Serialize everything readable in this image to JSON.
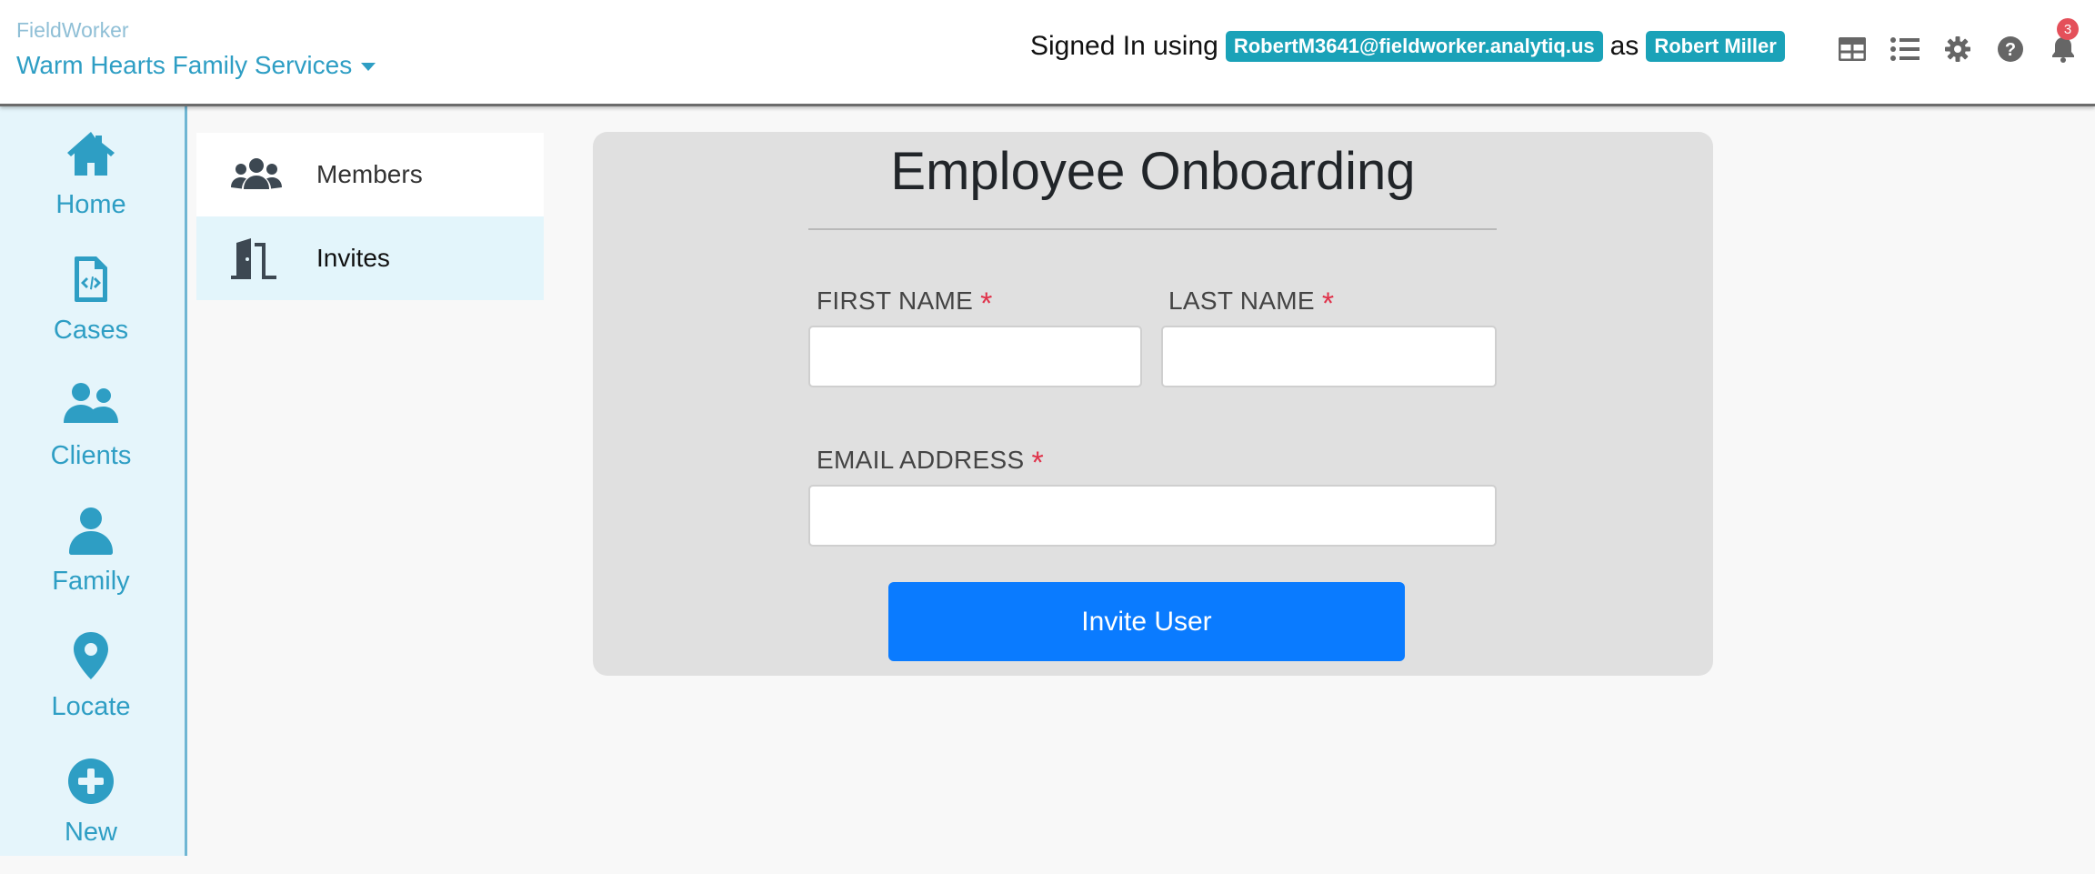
{
  "header": {
    "app_name": "FieldWorker",
    "org_name": "Warm Hearts Family Services",
    "signed_in_prefix": "Signed In using",
    "email": "RobertM3641@fieldworker.analytiq.us",
    "as_text": "as",
    "user_name": "Robert Miller",
    "icons": [
      "table-icon",
      "list-icon",
      "gear-icon",
      "help-icon",
      "bell-icon"
    ],
    "notification_count": "3"
  },
  "rail": {
    "items": [
      {
        "label": "Home",
        "icon": "home-icon"
      },
      {
        "label": "Cases",
        "icon": "file-code-icon"
      },
      {
        "label": "Clients",
        "icon": "users-icon"
      },
      {
        "label": "Family",
        "icon": "user-icon"
      },
      {
        "label": "Locate",
        "icon": "map-pin-icon"
      },
      {
        "label": "New",
        "icon": "plus-circle-icon"
      }
    ]
  },
  "subnav": {
    "items": [
      {
        "label": "Members",
        "icon": "users-icon"
      },
      {
        "label": "Invites",
        "icon": "door-open-icon"
      }
    ]
  },
  "form": {
    "title": "Employee Onboarding",
    "first_name_label": "FIRST NAME",
    "last_name_label": "LAST NAME",
    "email_label": "EMAIL ADDRESS",
    "required_mark": "*",
    "first_name_value": "",
    "last_name_value": "",
    "email_value": "",
    "submit_label": "Invite User"
  },
  "colors": {
    "accent": "#2e9ec4",
    "pill": "#1aa2b8",
    "primary_button": "#0a7bff",
    "required": "#e0324a",
    "badge": "#e4505a"
  }
}
